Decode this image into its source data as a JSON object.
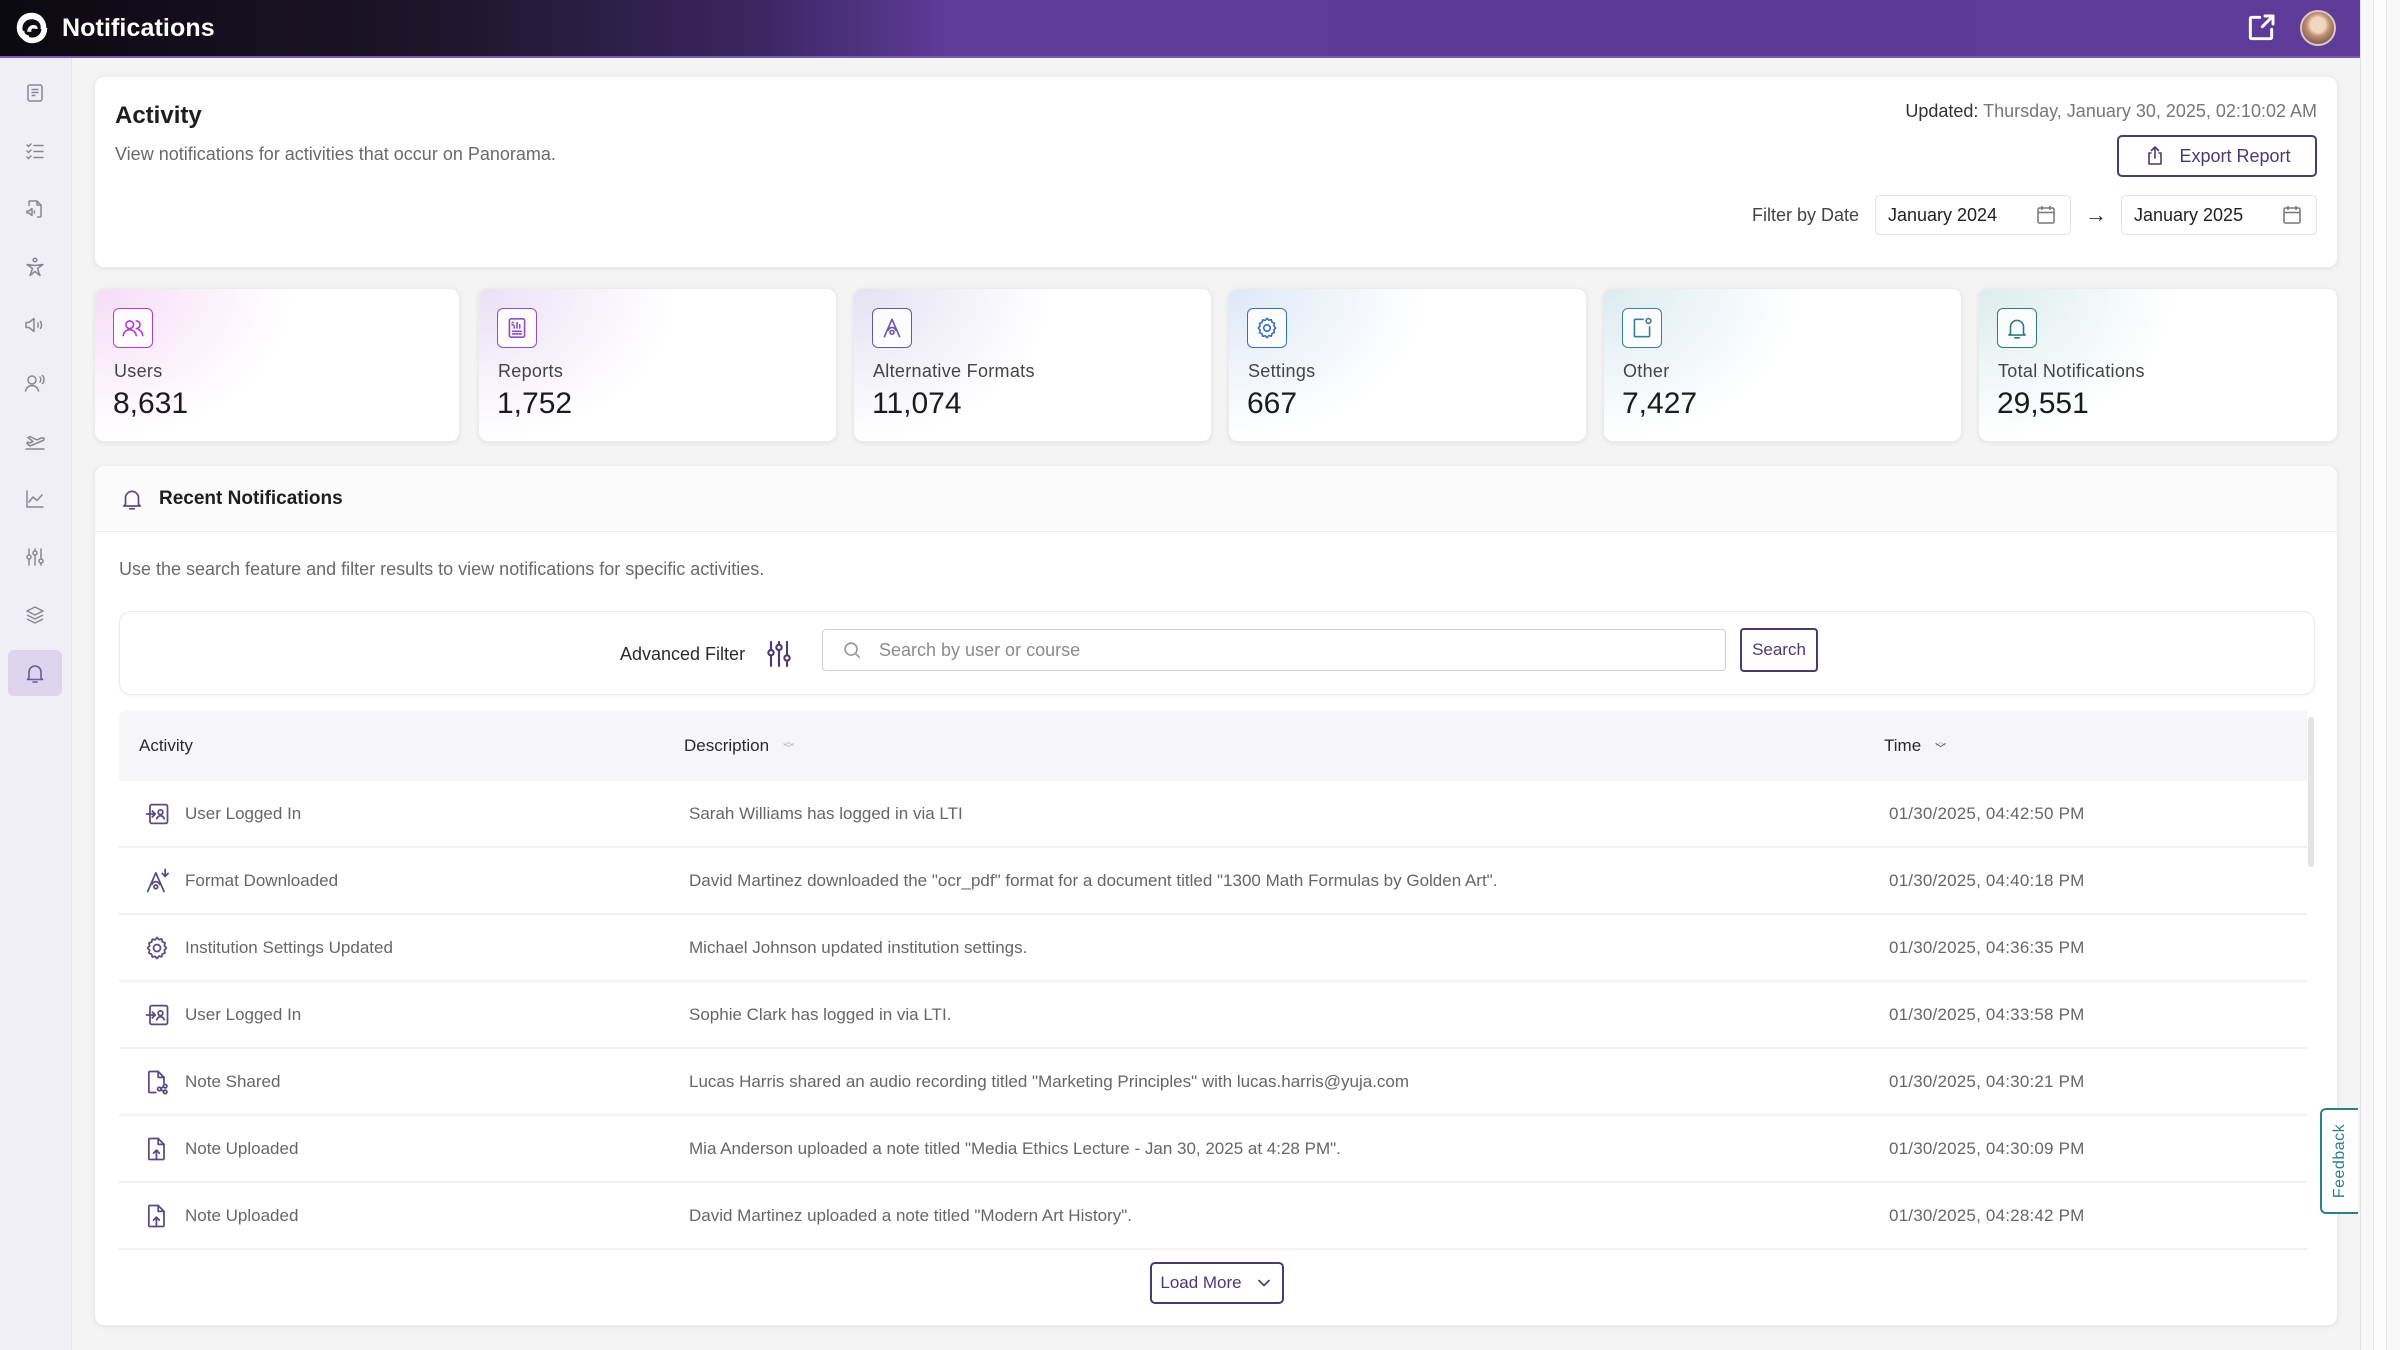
{
  "app": {
    "title": "Notifications",
    "logo_icon": "brand-swirl-logo",
    "external_link_icon": "external-link-icon",
    "avatar": "user-avatar"
  },
  "sidebar": {
    "items": [
      {
        "name": "document",
        "icon": "document-icon",
        "active": false
      },
      {
        "name": "checklist",
        "icon": "checklist-icon",
        "active": false
      },
      {
        "name": "audio-file",
        "icon": "audio-file-icon",
        "active": false
      },
      {
        "name": "accessibility",
        "icon": "accessibility-icon",
        "active": false
      },
      {
        "name": "speaker",
        "icon": "speaker-icon",
        "active": false
      },
      {
        "name": "voice-user",
        "icon": "voice-user-icon",
        "active": false
      },
      {
        "name": "takeoff",
        "icon": "plane-takeoff-icon",
        "active": false
      },
      {
        "name": "analytics",
        "icon": "line-chart-icon",
        "active": false
      },
      {
        "name": "adjustments",
        "icon": "sliders-icon",
        "active": false
      },
      {
        "name": "layers",
        "icon": "layers-icon",
        "active": false
      },
      {
        "name": "notifications",
        "icon": "bell-icon",
        "active": true
      }
    ]
  },
  "activity": {
    "title": "Activity",
    "subtitle": "View notifications for activities that occur on Panorama.",
    "updated_label": "Updated:",
    "updated_value": "Thursday, January 30, 2025, 02:10:02 AM",
    "export_label": "Export Report",
    "filter_label": "Filter by Date",
    "date_from": "January 2024",
    "date_to": "January 2025"
  },
  "stats": [
    {
      "label": "Users",
      "value": "8,631",
      "icon": "users-icon",
      "color": "#b13ec7",
      "tint": "#f5dcf7"
    },
    {
      "label": "Reports",
      "value": "1,752",
      "icon": "report-icon",
      "color": "#8f4fc4",
      "tint": "#ebe0f6"
    },
    {
      "label": "Alternative Formats",
      "value": "11,074",
      "icon": "alt-format-icon",
      "color": "#6a56a6",
      "tint": "#e4e1f2"
    },
    {
      "label": "Settings",
      "value": "667",
      "icon": "settings-icon",
      "color": "#3c6fb1",
      "tint": "#dde8f6"
    },
    {
      "label": "Other",
      "value": "7,427",
      "icon": "other-icon",
      "color": "#3a7f96",
      "tint": "#dcebf0"
    },
    {
      "label": "Total Notifications",
      "value": "29,551",
      "icon": "bell-icon",
      "color": "#2f7b7d",
      "tint": "#dcecec"
    }
  ],
  "recent": {
    "title": "Recent Notifications",
    "subtitle": "Use the search feature and filter results to view notifications for specific activities.",
    "advanced_filter_label": "Advanced Filter",
    "search_placeholder": "Search by user or course",
    "search_value": "",
    "search_button": "Search",
    "columns": {
      "activity": "Activity",
      "description": "Description",
      "time": "Time"
    },
    "sort": {
      "column": "time",
      "direction": "desc"
    },
    "rows": [
      {
        "activity": "User Logged In",
        "icon": "user-login-icon",
        "description": "Sarah Williams has logged in via LTI",
        "time": "01/30/2025, 04:42:50 PM"
      },
      {
        "activity": "Format Downloaded",
        "icon": "format-download-icon",
        "description": "David Martinez downloaded the \"ocr_pdf\" format for a document titled \"1300 Math Formulas by Golden Art\".",
        "time": "01/30/2025, 04:40:18 PM"
      },
      {
        "activity": "Institution Settings Updated",
        "icon": "settings-icon",
        "description": "Michael Johnson updated institution settings.",
        "time": "01/30/2025, 04:36:35 PM"
      },
      {
        "activity": "User Logged In",
        "icon": "user-login-icon",
        "description": "Sophie Clark has logged in via LTI.",
        "time": "01/30/2025, 04:33:58 PM"
      },
      {
        "activity": "Note Shared",
        "icon": "note-share-icon",
        "description": "Lucas Harris shared an audio recording titled \"Marketing Principles\" with lucas.harris@yuja.com",
        "time": "01/30/2025, 04:30:21 PM"
      },
      {
        "activity": "Note Uploaded",
        "icon": "note-upload-icon",
        "description": "Mia Anderson uploaded a note titled \"Media Ethics Lecture - Jan 30, 2025 at 4:28 PM\".",
        "time": "01/30/2025, 04:30:09 PM"
      },
      {
        "activity": "Note Uploaded",
        "icon": "note-upload-icon",
        "description": "David Martinez uploaded a note titled \"Modern Art History\".",
        "time": "01/30/2025, 04:28:42 PM"
      }
    ],
    "load_more": "Load More"
  },
  "feedback": {
    "label": "Feedback"
  },
  "colors": {
    "brand_purple": "#5e3a99",
    "button_border": "#4a3a72",
    "feedback_teal": "#2e7f8c",
    "sidebar_active": "#ddd5ee"
  }
}
